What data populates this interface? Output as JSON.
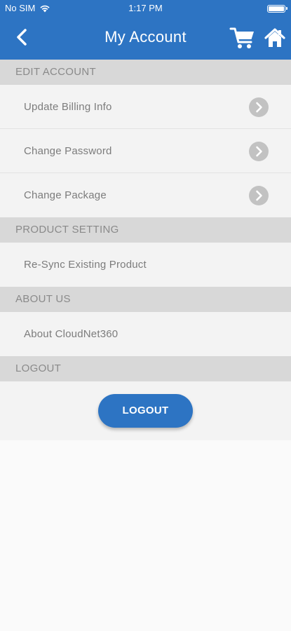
{
  "status_bar": {
    "carrier": "No SIM",
    "time": "1:17 PM"
  },
  "header": {
    "title": "My Account",
    "back_icon": "chevron-left-icon",
    "cart_icon": "cart-icon",
    "home_icon": "home-icon"
  },
  "sections": [
    {
      "title": "EDIT ACCOUNT"
    },
    {
      "title": "PRODUCT SETTING"
    },
    {
      "title": "ABOUT US"
    },
    {
      "title": "LOGOUT"
    }
  ],
  "rows": [
    {
      "label": "Update Billing Info"
    },
    {
      "label": "Change Password"
    },
    {
      "label": "Change Package"
    },
    {
      "label": "Re-Sync Existing Product"
    },
    {
      "label": "About CloudNet360"
    }
  ],
  "logout_button": {
    "label": "LOGOUT"
  },
  "colors": {
    "brand_blue": "#2d74c3",
    "section_bg": "#d8d8d8",
    "row_bg": "#f3f3f3",
    "chevron_bg": "#c2c2c2"
  }
}
